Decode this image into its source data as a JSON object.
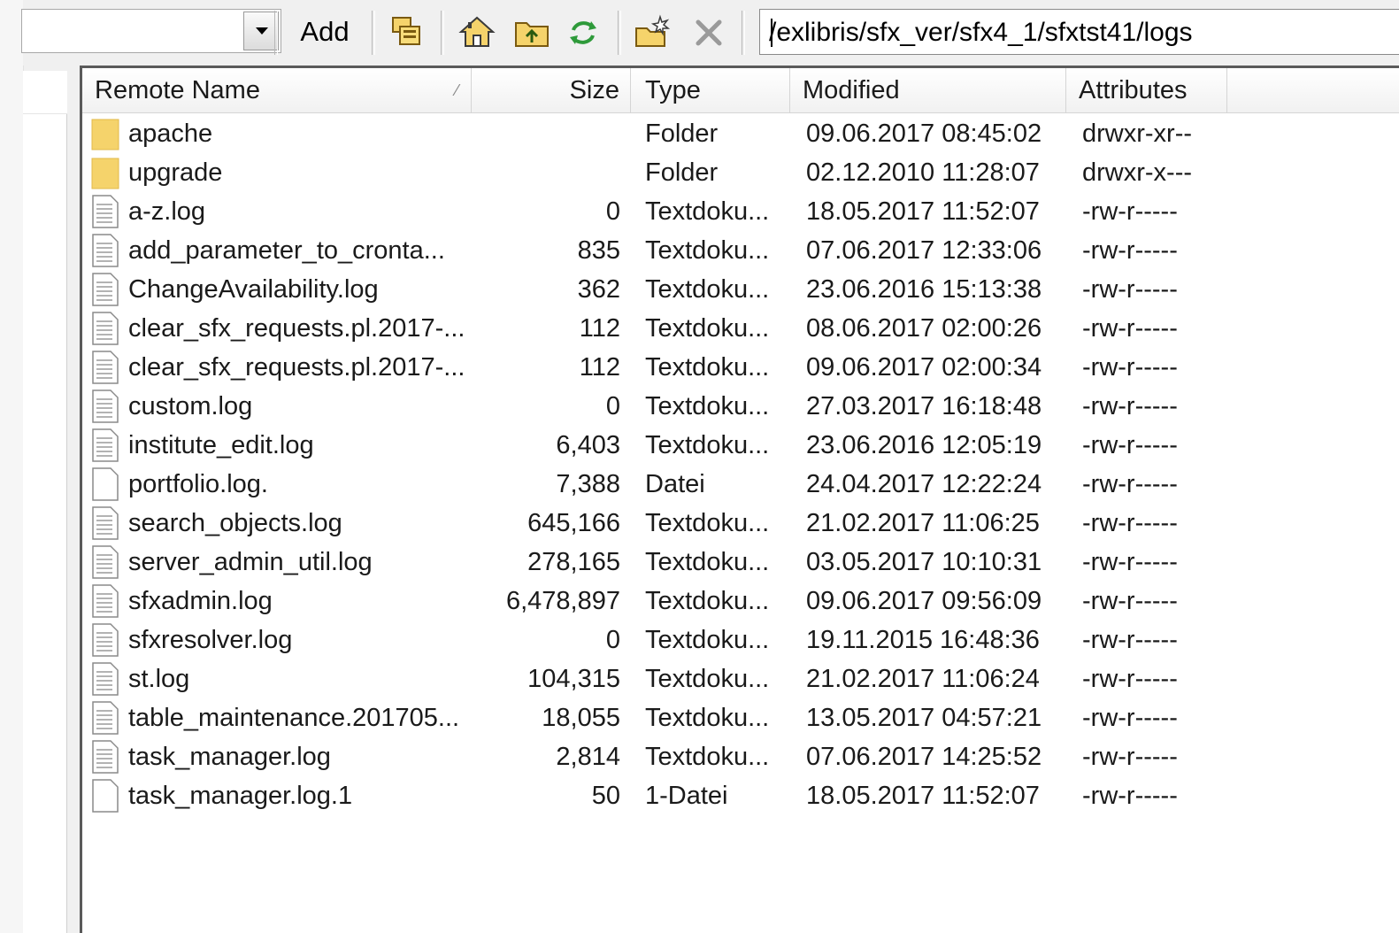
{
  "toolbar": {
    "add_label": "Add",
    "path": "/exlibris/sfx_ver/sfx4_1/sfxtst41/logs",
    "icons": [
      "copy-icon",
      "home-icon",
      "parent-folder-icon",
      "refresh-icon",
      "new-folder-icon",
      "delete-icon"
    ]
  },
  "columns": {
    "name": "Remote Name",
    "size": "Size",
    "type": "Type",
    "modified": "Modified",
    "attributes": "Attributes"
  },
  "files": [
    {
      "name": "apache",
      "size": "",
      "type": "Folder",
      "modified": "09.06.2017 08:45:02",
      "attributes": "drwxr-xr--",
      "icon": "folder"
    },
    {
      "name": "upgrade",
      "size": "",
      "type": "Folder",
      "modified": "02.12.2010 11:28:07",
      "attributes": "drwxr-x---",
      "icon": "folder"
    },
    {
      "name": "a-z.log",
      "size": "0",
      "type": "Textdoku...",
      "modified": "18.05.2017 11:52:07",
      "attributes": "-rw-r-----",
      "icon": "text"
    },
    {
      "name": "add_parameter_to_cronta...",
      "size": "835",
      "type": "Textdoku...",
      "modified": "07.06.2017 12:33:06",
      "attributes": "-rw-r-----",
      "icon": "text"
    },
    {
      "name": "ChangeAvailability.log",
      "size": "362",
      "type": "Textdoku...",
      "modified": "23.06.2016 15:13:38",
      "attributes": "-rw-r-----",
      "icon": "text"
    },
    {
      "name": "clear_sfx_requests.pl.2017-...",
      "size": "112",
      "type": "Textdoku...",
      "modified": "08.06.2017 02:00:26",
      "attributes": "-rw-r-----",
      "icon": "text"
    },
    {
      "name": "clear_sfx_requests.pl.2017-...",
      "size": "112",
      "type": "Textdoku...",
      "modified": "09.06.2017 02:00:34",
      "attributes": "-rw-r-----",
      "icon": "text"
    },
    {
      "name": "custom.log",
      "size": "0",
      "type": "Textdoku...",
      "modified": "27.03.2017 16:18:48",
      "attributes": "-rw-r-----",
      "icon": "text"
    },
    {
      "name": "institute_edit.log",
      "size": "6,403",
      "type": "Textdoku...",
      "modified": "23.06.2016 12:05:19",
      "attributes": "-rw-r-----",
      "icon": "text"
    },
    {
      "name": "portfolio.log.",
      "size": "7,388",
      "type": "Datei",
      "modified": "24.04.2017 12:22:24",
      "attributes": "-rw-r-----",
      "icon": "blank"
    },
    {
      "name": "search_objects.log",
      "size": "645,166",
      "type": "Textdoku...",
      "modified": "21.02.2017 11:06:25",
      "attributes": "-rw-r-----",
      "icon": "text"
    },
    {
      "name": "server_admin_util.log",
      "size": "278,165",
      "type": "Textdoku...",
      "modified": "03.05.2017 10:10:31",
      "attributes": "-rw-r-----",
      "icon": "text"
    },
    {
      "name": "sfxadmin.log",
      "size": "6,478,897",
      "type": "Textdoku...",
      "modified": "09.06.2017 09:56:09",
      "attributes": "-rw-r-----",
      "icon": "text"
    },
    {
      "name": "sfxresolver.log",
      "size": "0",
      "type": "Textdoku...",
      "modified": "19.11.2015 16:48:36",
      "attributes": "-rw-r-----",
      "icon": "text"
    },
    {
      "name": "st.log",
      "size": "104,315",
      "type": "Textdoku...",
      "modified": "21.02.2017 11:06:24",
      "attributes": "-rw-r-----",
      "icon": "text"
    },
    {
      "name": "table_maintenance.201705...",
      "size": "18,055",
      "type": "Textdoku...",
      "modified": "13.05.2017 04:57:21",
      "attributes": "-rw-r-----",
      "icon": "text"
    },
    {
      "name": "task_manager.log",
      "size": "2,814",
      "type": "Textdoku...",
      "modified": "07.06.2017 14:25:52",
      "attributes": "-rw-r-----",
      "icon": "text"
    },
    {
      "name": "task_manager.log.1",
      "size": "50",
      "type": "1-Datei",
      "modified": "18.05.2017 11:52:07",
      "attributes": "-rw-r-----",
      "icon": "blank"
    }
  ],
  "colors": {
    "folder": "#f5d36b",
    "window_bg": "#f0f0f0",
    "list_bg": "#ffffff"
  }
}
